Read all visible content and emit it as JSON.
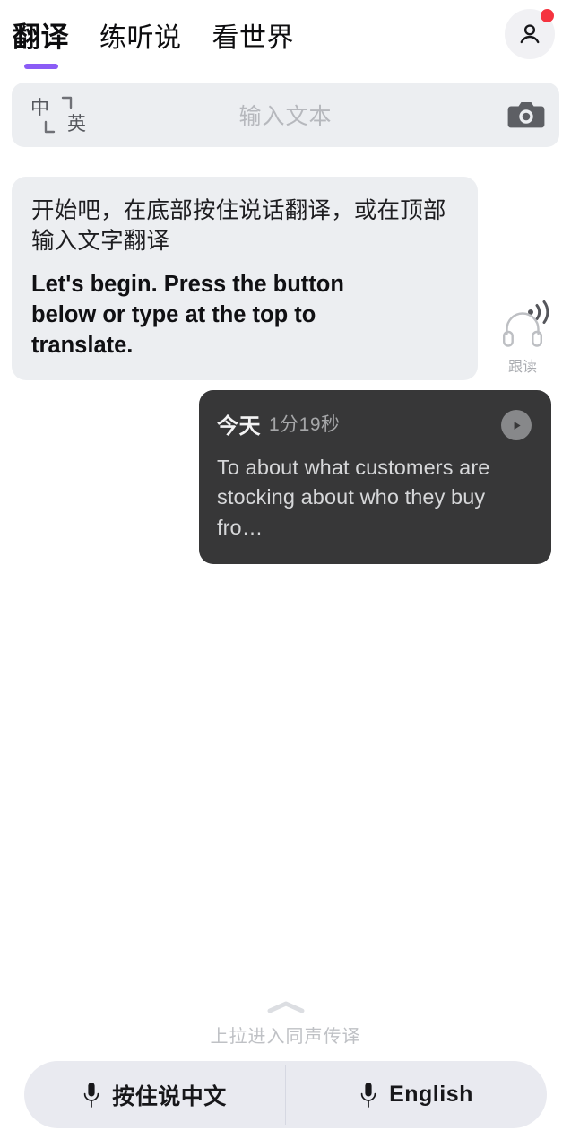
{
  "header": {
    "tabs": [
      {
        "label": "翻译",
        "active": true
      },
      {
        "label": "练听说",
        "active": false
      },
      {
        "label": "看世界",
        "active": false
      }
    ],
    "active_tab_accent": "#8b5cf6",
    "avatar": {
      "icon": "person-icon",
      "has_notification_badge": true,
      "badge_color": "#f5333f"
    }
  },
  "input_bar": {
    "lang_from": "中",
    "lang_to": "英",
    "swap_icon": "swap-arrows-icon",
    "placeholder": "输入文本",
    "camera_icon": "camera-icon",
    "background": "#eceef1"
  },
  "conversation": {
    "messages": [
      {
        "type": "system-prompt",
        "align": "left",
        "source_text": "开始吧，在底部按住说话翻译，或在顶部输入文字翻译",
        "translated_text": "Let's begin. Press the button below or type at the top to translate.",
        "speaker_icon": "sound-wave-icon",
        "background": "#eceef1"
      },
      {
        "type": "recording",
        "align": "right",
        "day_label": "今天",
        "duration": "1分19秒",
        "play_icon": "play-icon",
        "text": "To about what customers are stocking about who they buy fro…",
        "background": "#373738"
      }
    ],
    "follow_read": {
      "icon": "headphones-icon",
      "label": "跟读"
    }
  },
  "footer": {
    "pull_up": {
      "chevron_icon": "chevron-up-icon",
      "label": "上拉进入同声传译"
    },
    "mic_buttons": [
      {
        "icon": "microphone-icon",
        "label": "按住说中文"
      },
      {
        "icon": "microphone-icon",
        "label": "English"
      }
    ],
    "bar_background": "#e9eaf0"
  }
}
